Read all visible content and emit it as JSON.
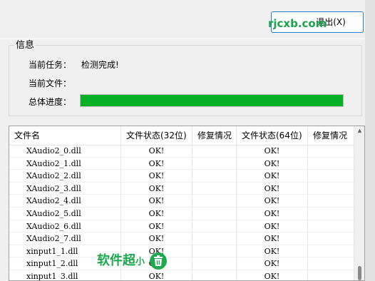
{
  "toolbar": {
    "exit_label": "退出(X)",
    "watermark": "rjcxb.com"
  },
  "info": {
    "group_title": "信息",
    "task_label": "当前任务：",
    "task_value": "检测完成!",
    "file_label": "当前文件：",
    "file_value": "",
    "progress_label": "总体进度：",
    "progress_fraction": 1.0,
    "progress_color": "#06b025"
  },
  "table": {
    "columns": [
      "文件名",
      "文件状态(32位)",
      "修复情况",
      "文件状态(64位)",
      "修复情况"
    ],
    "rows": [
      {
        "name": "XAudio2_0.dll",
        "s32": "OK!",
        "f32": "",
        "s64": "OK!",
        "f64": ""
      },
      {
        "name": "XAudio2_1.dll",
        "s32": "OK!",
        "f32": "",
        "s64": "OK!",
        "f64": ""
      },
      {
        "name": "XAudio2_2.dll",
        "s32": "OK!",
        "f32": "",
        "s64": "OK!",
        "f64": ""
      },
      {
        "name": "XAudio2_3.dll",
        "s32": "OK!",
        "f32": "",
        "s64": "OK!",
        "f64": ""
      },
      {
        "name": "XAudio2_4.dll",
        "s32": "OK!",
        "f32": "",
        "s64": "OK!",
        "f64": ""
      },
      {
        "name": "XAudio2_5.dll",
        "s32": "OK!",
        "f32": "",
        "s64": "OK!",
        "f64": ""
      },
      {
        "name": "XAudio2_6.dll",
        "s32": "OK!",
        "f32": "",
        "s64": "OK!",
        "f64": ""
      },
      {
        "name": "XAudio2_7.dll",
        "s32": "OK!",
        "f32": "",
        "s64": "OK!",
        "f64": ""
      },
      {
        "name": "xinput1_1.dll",
        "s32": "OK!",
        "f32": "",
        "s64": "OK!",
        "f64": ""
      },
      {
        "name": "xinput1_2.dll",
        "s32": "OK!",
        "f32": "",
        "s64": "OK!",
        "f64": ""
      },
      {
        "name": "xinput1_3.dll",
        "s32": "OK!",
        "f32": "",
        "s64": "OK!",
        "f64": ""
      }
    ]
  },
  "watermark_bottom": {
    "text": "软件超",
    "small": "小"
  }
}
